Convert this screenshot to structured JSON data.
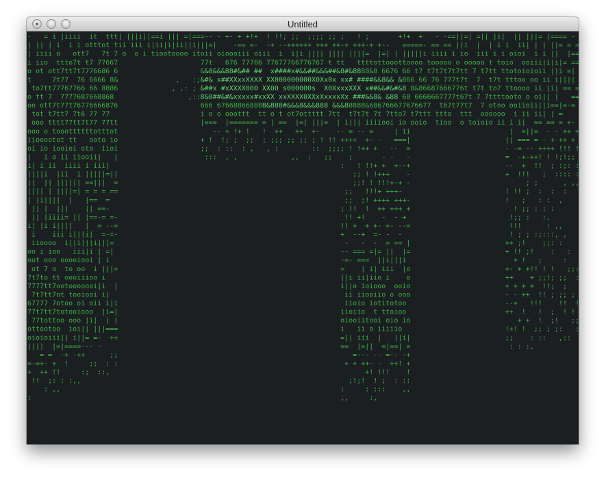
{
  "window": {
    "title": "Untitled"
  },
  "ascii_art": {
    "description_fallback": "",
    "palette": [
      ".",
      ",",
      ":",
      ";",
      "!",
      "+",
      "-",
      "=",
      "|",
      "i",
      "o",
      "t",
      "7",
      "6",
      "8",
      "&",
      "#",
      "x",
      "X",
      "0",
      "s",
      "%"
    ],
    "foreground_color": "#3cb043",
    "background_color": "#1c1f22"
  },
  "colors": {
    "window_bg": "#1c1f22",
    "titlebar_top": "#ebebeb",
    "titlebar_bottom": "#c9c9c9",
    "ascii_green": "#3cb043",
    "ascii_green_bright": "#5ad16a"
  },
  "icons": {
    "close": "close-icon",
    "minimize": "minimize-icon",
    "zoom": "zoom-icon"
  }
}
